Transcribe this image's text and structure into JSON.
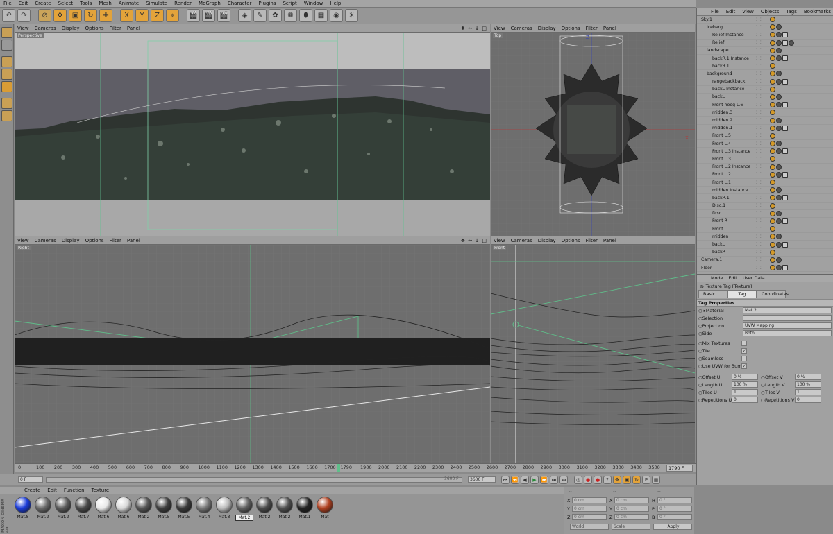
{
  "menu": [
    "File",
    "Edit",
    "Create",
    "Select",
    "Tools",
    "Mesh",
    "Animate",
    "Simulate",
    "Render",
    "MoGraph",
    "Character",
    "Plugins",
    "Script",
    "Window",
    "Help"
  ],
  "viewport_menu": [
    "View",
    "Cameras",
    "Display",
    "Options",
    "Filter",
    "Panel"
  ],
  "viewport_controls": "❖ ↔ ↓ □",
  "viewports": {
    "perspective": "Perspective",
    "top": "Top",
    "right": "Right",
    "front": "Front"
  },
  "axis": {
    "x": "X",
    "y": "Y",
    "z": "Z"
  },
  "object_manager": {
    "menu": [
      "File",
      "Edit",
      "View",
      "Objects",
      "Tags",
      "Bookmarks"
    ],
    "objects": [
      "Sky.1",
      "iceberg",
      "Relief Instance",
      "Relief",
      "landscape",
      "backR.1 Instance",
      "backR.1",
      "background",
      "rangebackback",
      "backL Instance",
      "backL",
      "Front hoog L.6",
      "midden.3",
      "midden.2",
      "midden.1",
      "Front L.5",
      "Front L.4",
      "Front L.3 Instance",
      "Front L.3",
      "Front L.2 Instance",
      "Front L.2",
      "Front L.1",
      "midden Instance",
      "backR.1",
      "Disc.1",
      "Disc",
      "Front R",
      "Front L",
      "midden",
      "backL",
      "backR",
      "Camera.1",
      "Floor"
    ]
  },
  "attribute_manager": {
    "menu": [
      "Mode",
      "Edit",
      "User Data"
    ],
    "title": "Texture Tag [Texture]",
    "tabs": [
      "Basic",
      "Tag",
      "Coordinates"
    ],
    "active_tab": "Tag",
    "section": "Tag Properties",
    "material_label": "Material",
    "material_value": "Mat.2",
    "selection_label": "Selection",
    "projection_label": "Projection",
    "projection_value": "UVW Mapping",
    "side_label": "Side",
    "side_value": "Both",
    "mix_label": "Mix Textures",
    "tile_label": "Tile",
    "seamless_label": "Seamless",
    "uvw_label": "Use UVW for Bump",
    "check": "✓",
    "offset_u_label": "Offset U",
    "offset_u": "0 %",
    "offset_v_label": "Offset V",
    "offset_v": "0 %",
    "length_u_label": "Length U",
    "length_u": "100 %",
    "length_v_label": "Length V",
    "length_v": "100 %",
    "tiles_u_label": "Tiles U",
    "tiles_u": "1",
    "tiles_v_label": "Tiles V",
    "tiles_v": "1",
    "rep_u_label": "Repetitions U",
    "rep_u": "0",
    "rep_v_label": "Repetitions V",
    "rep_v": "0"
  },
  "timeline": {
    "ticks": [
      "0",
      "100",
      "200",
      "300",
      "400",
      "500",
      "600",
      "700",
      "800",
      "900",
      "1000",
      "1100",
      "1200",
      "1300",
      "1400",
      "1500",
      "1600",
      "1700",
      "1790",
      "1900",
      "2000",
      "2100",
      "2200",
      "2300",
      "2400",
      "2500",
      "2600",
      "2700",
      "2800",
      "2900",
      "3000",
      "3100",
      "3200",
      "3300",
      "3400",
      "3500",
      "3600"
    ],
    "end_frame": "1790 F",
    "current": "0 F",
    "max_frame": "3600 F",
    "max_frame2": "3600 F"
  },
  "material_manager": {
    "menu": [
      "Create",
      "Edit",
      "Function",
      "Texture"
    ],
    "materials": [
      "Mat.8",
      "Mat.2",
      "Mat.2",
      "Mat.7",
      "Mat.6",
      "Mat.6",
      "Mat.2",
      "Mat.5",
      "Mat.5",
      "Mat.4",
      "Mat.3",
      "Mat.2",
      "Mat.2",
      "Mat.2",
      "Mat.1",
      "Mat"
    ],
    "selected": "Mat.2",
    "brand": "MAXON CINEMA 4D"
  },
  "coordinates": {
    "header": [
      "--",
      "--",
      "--"
    ],
    "x_label": "X",
    "y_label": "Y",
    "z_label": "Z",
    "h_label": "H",
    "p_label": "P",
    "b_label": "B",
    "x_val": "0 cm",
    "y_val": "0 cm",
    "z_val": "0 cm",
    "h_val": "0 °",
    "p_val": "0 °",
    "b_val": "0 °",
    "world": "World",
    "scale": "Scale",
    "apply": "Apply"
  }
}
